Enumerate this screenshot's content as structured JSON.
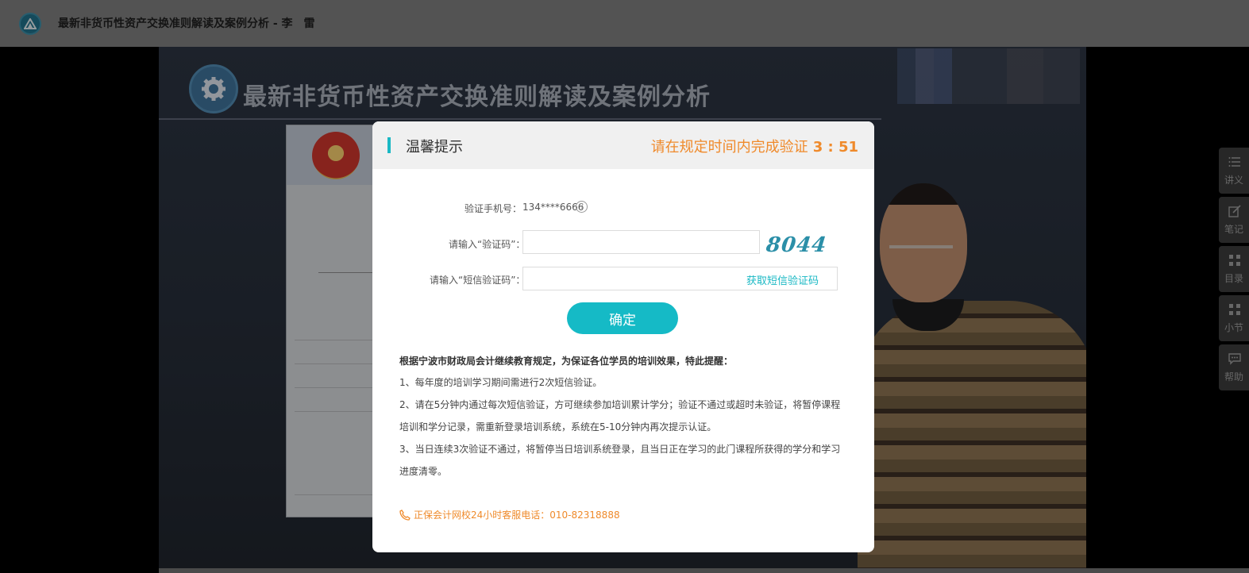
{
  "header": {
    "title": "最新非货币性资产交换准则解读及案例分析 - 李　雷"
  },
  "video": {
    "title": "最新非货币性资产交换准则解读及案例分析"
  },
  "right_rail": {
    "items": [
      {
        "label": "讲义",
        "icon": "list-icon"
      },
      {
        "label": "笔记",
        "icon": "edit-icon"
      },
      {
        "label": "目录",
        "icon": "grid-icon"
      },
      {
        "label": "小节",
        "icon": "grid-icon"
      },
      {
        "label": "帮助",
        "icon": "chat-icon"
      }
    ]
  },
  "modal": {
    "title": "温馨提示",
    "countdown_prefix": "请在规定时间内完成验证",
    "countdown_value": "3 : 51",
    "phone_label": "验证手机号：",
    "phone_value": "134****6666",
    "help_glyph": "?",
    "captcha_label": "请输入“验证码”：",
    "captcha_value": "",
    "captcha_image_text": "8044",
    "sms_label": "请输入“短信验证码”：",
    "sms_value": "",
    "sms_button": "获取短信验证码",
    "confirm_button": "确定",
    "notice_title": "根据宁波市财政局会计继续教育规定，为保证各位学员的培训效果，特此提醒：",
    "notice_lines": [
      "1、每年度的培训学习期间需进行2次短信验证。",
      "2、请在5分钟内通过每次短信验证，方可继续参加培训累计学分；验证不通过或超时未验证，将暂停课程",
      "培训和学分记录，需重新登录培训系统，系统在5-10分钟内再次提示认证。",
      "3、当日连续3次验证不通过，将暂停当日培训系统登录，且当日正在学习的此门课程所获得的学分和学习",
      "进度清零。"
    ],
    "hotline": "正保会计网校24小时客服电话：010-82318888"
  },
  "colors": {
    "accent": "#15bac6",
    "countdown": "#ef8a2b",
    "header_bg": "#7b7b7b"
  }
}
